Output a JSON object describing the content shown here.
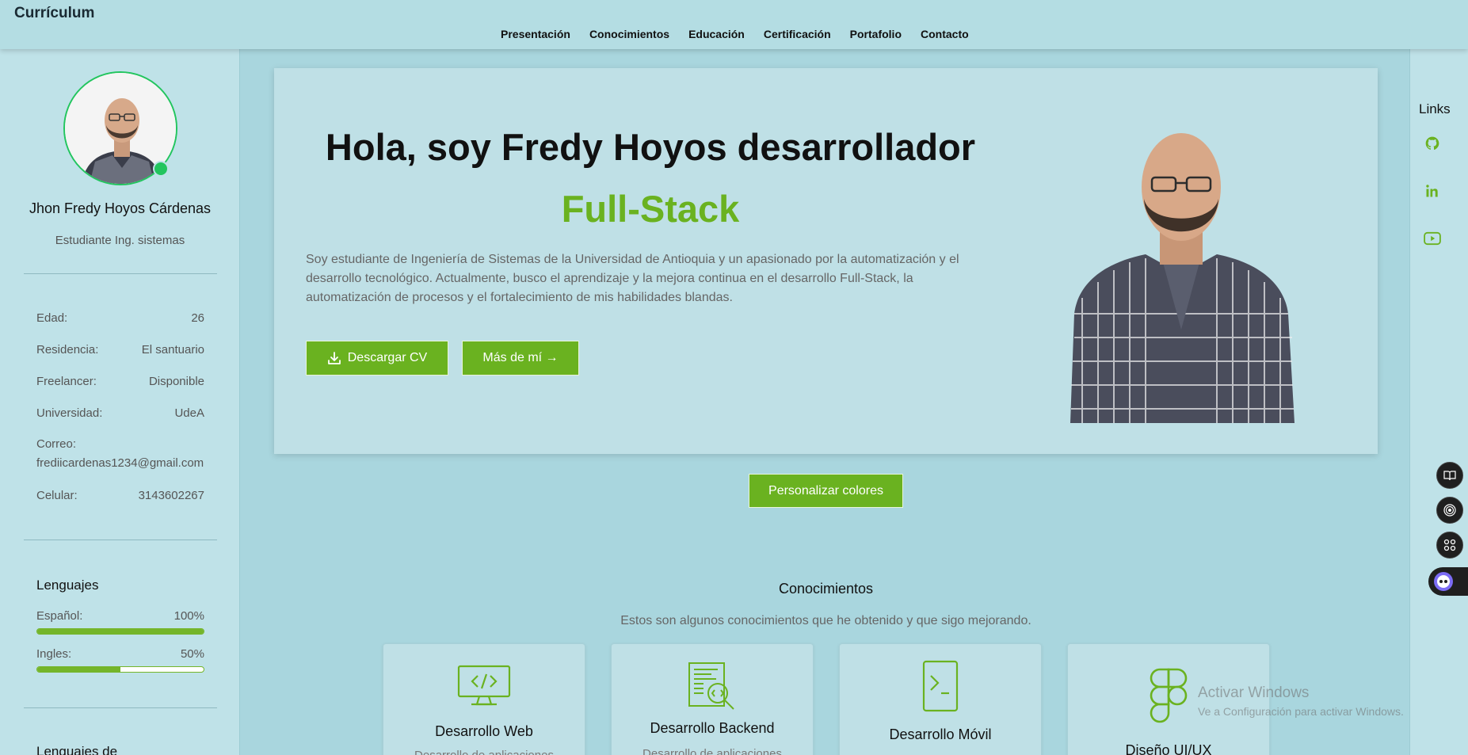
{
  "header": {
    "brand": "Currículum",
    "nav": [
      "Presentación",
      "Conocimientos",
      "Educación",
      "Certificación",
      "Portafolio",
      "Contacto"
    ]
  },
  "sidebar": {
    "name": "Jhon Fredy Hoyos Cárdenas",
    "role": "Estudiante Ing. sistemas",
    "info": [
      {
        "label": "Edad:",
        "value": "26"
      },
      {
        "label": "Residencia:",
        "value": "El santuario"
      },
      {
        "label": "Freelancer:",
        "value": "Disponible"
      },
      {
        "label": "Universidad:",
        "value": "UdeA"
      }
    ],
    "email_label": "Correo:",
    "email": "frediicardenas1234@gmail.com",
    "phone_label": "Celular:",
    "phone": "3143602267",
    "languages_title": "Lenguajes",
    "languages": [
      {
        "label": "Español:",
        "value": "100%",
        "level": 1.0
      },
      {
        "label": "Ingles:",
        "value": "50%",
        "level": 0.5
      }
    ],
    "bottom_title": "Lenguajes de"
  },
  "links": {
    "title": "Links",
    "icons": [
      "github-icon",
      "linkedin-icon",
      "youtube-icon"
    ]
  },
  "hero": {
    "title": "Hola, soy Fredy Hoyos desarrollador",
    "subtitle": "Full-Stack",
    "text": "Soy estudiante de Ingeniería de Sistemas de la Universidad de Antioquia y un apasionado por la automatización y el desarrollo tecnológico. Actualmente, busco el aprendizaje y la mejora continua en el desarrollo Full-Stack, la automatización de procesos y el fortalecimiento de mis habilidades blandas.",
    "download_label": "Descargar CV",
    "more_label": "Más de mí →"
  },
  "customize_label": "Personalizar colores",
  "knowledge": {
    "title": "Conocimientos",
    "subtitle": "Estos son algunos conocimientos que he obtenido y que sigo mejorando.",
    "cards": [
      {
        "title": "Desarrollo Web",
        "desc": "Desarrollo de aplicaciones",
        "icon": "monitor-code-icon"
      },
      {
        "title": "Desarrollo Backend",
        "desc": "Desarrollo de aplicaciones",
        "icon": "code-document-icon"
      },
      {
        "title": "Desarrollo Móvil",
        "desc": "",
        "icon": "mobile-terminal-icon"
      },
      {
        "title": "Diseño UI/UX",
        "desc": "",
        "icon": "figma-icon"
      }
    ]
  },
  "watermark": {
    "line1": "Activar Windows",
    "line2": "Ve a Configuración para activar Windows."
  },
  "colors": {
    "accent": "#6ab220",
    "status": "#22c55e",
    "background": "#a9d6de"
  }
}
